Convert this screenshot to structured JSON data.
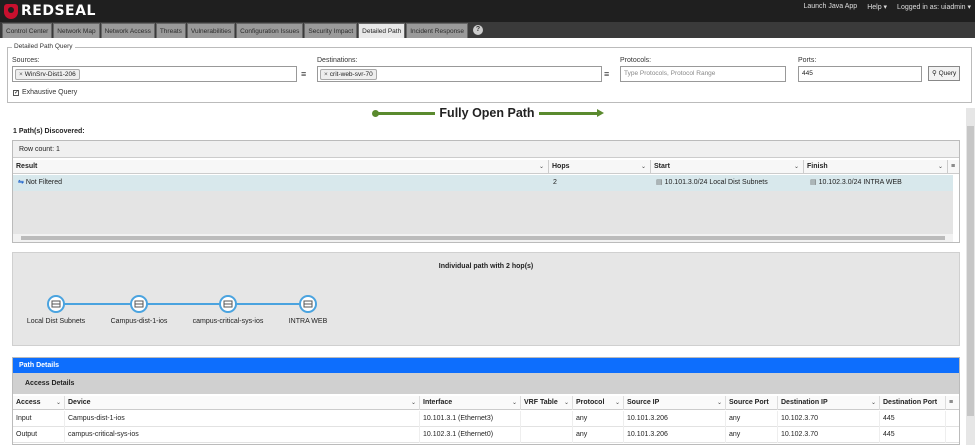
{
  "brand": {
    "name": "REDSEAL"
  },
  "top_links": [
    "Launch Java App",
    "Help ▾",
    "Logged in as: uiadmin ▾"
  ],
  "tabs": [
    {
      "label": "Control Center",
      "active": false
    },
    {
      "label": "Network Map",
      "active": false
    },
    {
      "label": "Network Access",
      "active": false
    },
    {
      "label": "Threats",
      "active": false
    },
    {
      "label": "Vulnerabilities",
      "active": false
    },
    {
      "label": "Configuration Issues",
      "active": false
    },
    {
      "label": "Security Impact",
      "active": false
    },
    {
      "label": "Detailed Path",
      "active": true
    },
    {
      "label": "Incident Response",
      "active": false
    }
  ],
  "query": {
    "legend": "Detailed Path Query",
    "sources_label": "Sources:",
    "sources_chip": "WinSrv-Dist1-206",
    "destinations_label": "Destinations:",
    "destinations_chip": "crit-web-svr-70",
    "protocols_label": "Protocols:",
    "protocols_placeholder": "Type Protocols, Protocol Range",
    "ports_label": "Ports:",
    "ports_value": "445",
    "query_button": "Query",
    "exhaustive_label": "Exhaustive Query",
    "exhaustive_checked": true
  },
  "path_title": "Fully Open Path",
  "path_title_color": "#5a8a2e",
  "results": {
    "discovered": "1 Path(s) Discovered:",
    "row_count": "Row count: 1",
    "columns": [
      "Result",
      "Hops",
      "Start",
      "Finish"
    ],
    "rows": [
      {
        "result": "Not Filtered",
        "hops": "2",
        "start": "10.101.3.0/24 Local Dist Subnets",
        "finish": "10.102.3.0/24 INTRA WEB"
      }
    ]
  },
  "hops": {
    "title": "Individual path with 2 hop(s)",
    "nodes": [
      "Local Dist Subnets",
      "Campus-dist-1-ios",
      "campus-critical-sys-ios",
      "INTRA WEB"
    ]
  },
  "details": {
    "header": "Path Details",
    "subheader": "Access Details",
    "columns": [
      "Access",
      "Device",
      "Interface",
      "VRF Table",
      "Protocol",
      "Source IP",
      "Source Port",
      "Destination IP",
      "Destination Port"
    ],
    "rows": [
      {
        "access": "Input",
        "device": "Campus-dist-1-ios",
        "interface": "10.101.3.1 (Ethernet3)",
        "vrf": "",
        "protocol": "any",
        "source_ip": "10.101.3.206",
        "source_port": "any",
        "dest_ip": "10.102.3.70",
        "dest_port": "445"
      },
      {
        "access": "Output",
        "device": "campus-critical-sys-ios",
        "interface": "10.102.3.1 (Ethernet0)",
        "vrf": "",
        "protocol": "any",
        "source_ip": "10.101.3.206",
        "source_port": "any",
        "dest_ip": "10.102.3.70",
        "dest_port": "445"
      }
    ]
  },
  "accent_colors": {
    "header_blue": "#0d6efd",
    "node_blue": "#4aa3df",
    "row_highlight": "#d8e8ec"
  }
}
